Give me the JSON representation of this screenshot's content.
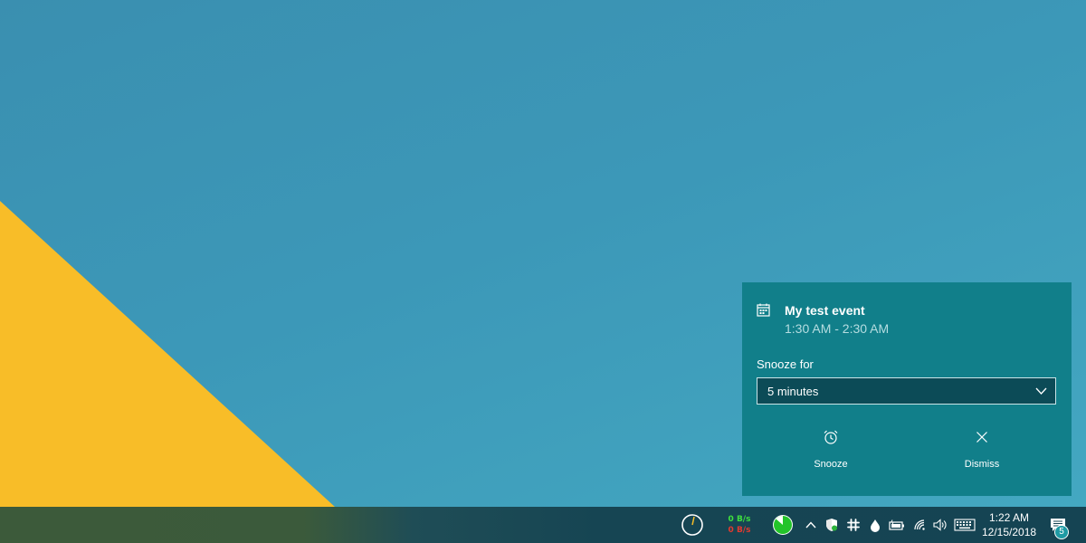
{
  "notification": {
    "title": "My test event",
    "time": "1:30 AM - 2:30 AM",
    "snooze_label": "Snooze for",
    "snooze_selected": "5 minutes",
    "actions": {
      "snooze": {
        "label": "Snooze",
        "icon": "alarm-clock-icon"
      },
      "dismiss": {
        "label": "Dismiss",
        "icon": "close-icon"
      }
    },
    "icon": "calendar-icon"
  },
  "taskbar": {
    "net_up": "0 B/s",
    "net_down": "0 B/s",
    "clock_time": "1:22 AM",
    "clock_date": "12/15/2018",
    "notification_count": "5",
    "tray_icons": [
      "cpu-gauge-icon",
      "network-speed-meter",
      "memory-usage-icon",
      "show-hidden-icons-chevron",
      "shield-icon",
      "slack-icon",
      "water-drop-icon",
      "battery-icon",
      "wifi-icon",
      "volume-icon",
      "keyboard-icon",
      "action-center-icon"
    ]
  },
  "colors": {
    "desktop_blue": "#3c98b8",
    "wallpaper_yellow": "#f8bd28",
    "toast_bg": "#117f8a",
    "select_bg": "#0c4b57",
    "net_up": "#3ee03e",
    "net_down": "#e33a2f"
  }
}
